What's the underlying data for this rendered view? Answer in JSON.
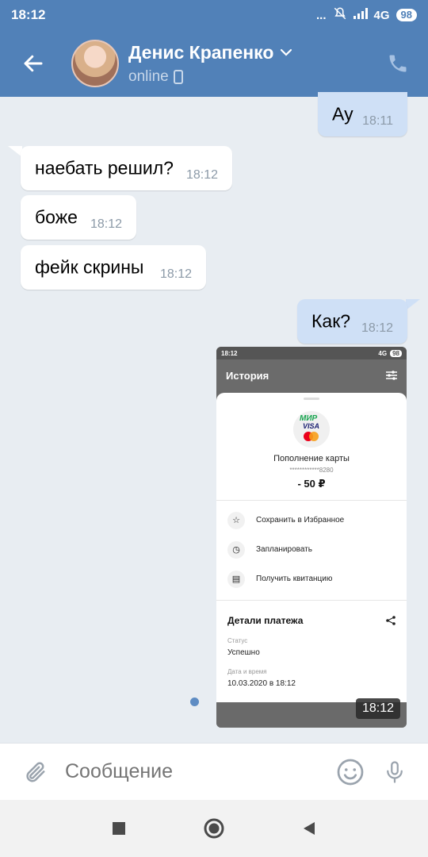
{
  "status_bar": {
    "time": "18:12",
    "dots": "...",
    "network": "4G",
    "battery": "98"
  },
  "header": {
    "name": "Денис Крапенко",
    "presence": "online"
  },
  "messages": [
    {
      "text": "Ау",
      "time": "18:11",
      "direction": "out"
    },
    {
      "text": "наебать решил?",
      "time": "18:12",
      "direction": "in"
    },
    {
      "text": "боже",
      "time": "18:12",
      "direction": "in"
    },
    {
      "text": "фейк скрины",
      "time": "18:12",
      "direction": "in"
    },
    {
      "text": "Как?",
      "time": "18:12",
      "direction": "out"
    }
  ],
  "attachment": {
    "time": "18:12",
    "screenshot": {
      "status_time": "18:12",
      "status_network": "4G",
      "status_battery": "98",
      "title": "История",
      "card_brand_mir": "МИР",
      "card_brand_visa": "VISA",
      "operation": "Пополнение карты",
      "card_number": "************8280",
      "amount": "- 50 ₽",
      "actions": [
        "Сохранить в Избранное",
        "Запланировать",
        "Получить квитанцию"
      ],
      "details_title": "Детали платежа",
      "status_label": "Статус",
      "status_value": "Успешно",
      "datetime_label": "Дата и время",
      "datetime_value": "10.03.2020 в 18:12"
    }
  },
  "composer": {
    "placeholder": "Сообщение"
  },
  "colors": {
    "header_bg": "#5181b8",
    "chat_bg": "#e8edf2",
    "outgoing_bubble": "#cfe0f6",
    "incoming_bubble": "#ffffff"
  }
}
